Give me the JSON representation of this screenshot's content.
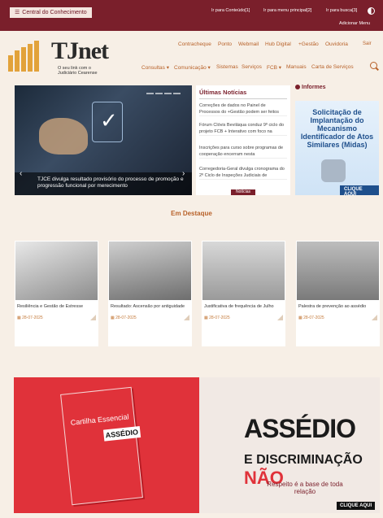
{
  "topbar": {
    "kb_label": "Central do Conhecimento",
    "kb_icon": "menu-icon",
    "access_links": [
      "Ir para Conteúdo[1]",
      "Ir para menu principal[2]",
      "Ir para busca[3]"
    ],
    "add_menu": "Adicionar Menu",
    "contrast_icon": "contrast-icon"
  },
  "logo": {
    "title": "TJnet",
    "subtitle_1": "O seu link com o",
    "subtitle_2": "Judiciário Cearense"
  },
  "nav_top": [
    "Contracheque",
    "Ponto",
    "Webmail",
    "Hub Digital",
    "+Gestão",
    "Ouvidoria"
  ],
  "nav_logout": "Sair",
  "nav_main": [
    "Consultas ▾",
    "Comunicação ▾",
    "Sistemas",
    "Serviços",
    "FCB ▾",
    "Manuais",
    "Carta de Serviços"
  ],
  "hero": {
    "caption": "TJCE divulga resultado provisório do processo de promoção e progressão funcional por merecimento",
    "prev": "‹",
    "next": "›"
  },
  "news": {
    "title": "Últimas Notícias",
    "items": [
      "Correções de dados no Painel de Processos do +Gestão podem ser feitos",
      "Fórum Clóvis Beviláqua conduz 9º ciclo do projeto FCB + Interativo com foco na",
      "Inscrições para curso sobre programas de cooperação encerram nesta",
      "Corregedoria-Geral divulga cronograma do 2º Ciclo de Inspeções Judiciais de"
    ],
    "tab": "Notícias"
  },
  "informes": {
    "title": "Informes",
    "midas_text": "Solicitação de Implantação do Mecanismo Identificador de Atos Similares (Midas)",
    "cta": "CLIQUE AQUI"
  },
  "destaque": {
    "title": "Em Destaque",
    "cards": [
      {
        "title": "Resiliência e Gestão de Estresse",
        "date": "28-07-2025"
      },
      {
        "title": "Resultado: Ascensão por antiguidade",
        "date": "28-07-2025"
      },
      {
        "title": "Justificativa de frequência de Julho",
        "date": "28-07-2025"
      },
      {
        "title": "Palestra de prevenção ao assédio",
        "date": "28-07-2025"
      }
    ]
  },
  "banner": {
    "book_title": "Cartilha Essencial",
    "book_tag": "ASSÉDIO",
    "headline": "ASSÉDIO",
    "sub_1": "E DISCRIMINAÇÃO",
    "sub_2": "NÃO",
    "tagline": "Respeito é a base de toda relação",
    "cta": "CLIQUE AQUI"
  },
  "colors": {
    "brand": "#7a1f2b",
    "accent": "#b8622a",
    "banner_red": "#e0323a"
  }
}
